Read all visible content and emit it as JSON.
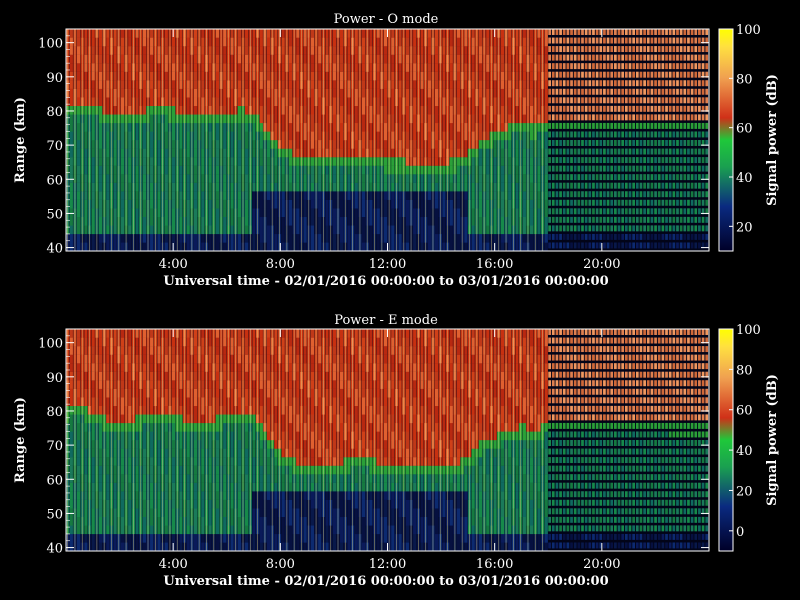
{
  "chart_data": [
    {
      "type": "heatmap",
      "title": "Power - O mode",
      "xlabel": "Universal time - 02/01/2016 00:00:00 to 03/01/2016 00:00:00",
      "ylabel": "Range (km)",
      "xticks": [
        "4:00",
        "8:00",
        "12:00",
        "16:00",
        "20:00"
      ],
      "xtick_hours": [
        4,
        8,
        12,
        16,
        20
      ],
      "xlim_hours": [
        0,
        24
      ],
      "yticks": [
        40,
        50,
        60,
        70,
        80,
        90,
        100
      ],
      "ylim": [
        39,
        104
      ],
      "colorbar": {
        "label": "Signal power (dB)",
        "ticks": [
          20,
          40,
          60,
          80,
          100
        ],
        "range": [
          10,
          100
        ]
      },
      "boundary_profile": {
        "hours": [
          0,
          0.5,
          1,
          1.5,
          2,
          2.5,
          3,
          3.5,
          4,
          4.5,
          5,
          5.5,
          6,
          6.5,
          7,
          7.5,
          8,
          8.5,
          9,
          9.5,
          10,
          10.5,
          11,
          11.5,
          12,
          12.5,
          13,
          13.5,
          14,
          14.5,
          15,
          15.5,
          16,
          16.5,
          17,
          17.5,
          18,
          24
        ],
        "km": [
          80,
          81,
          80,
          78,
          77,
          77,
          79,
          80,
          79,
          78,
          77,
          77,
          78,
          79,
          78,
          73,
          68,
          66,
          65,
          65,
          65,
          66,
          66,
          65,
          64,
          64,
          63,
          63,
          63,
          64,
          66,
          70,
          72,
          74,
          75,
          74,
          75,
          75
        ]
      },
      "dark_floor_km": 57
    },
    {
      "type": "heatmap",
      "title": "Power - E mode",
      "xlabel": "Universal time - 02/01/2016 00:00:00 to 03/01/2016 00:00:00",
      "ylabel": "Range (km)",
      "xticks": [
        "4:00",
        "8:00",
        "12:00",
        "16:00",
        "20:00"
      ],
      "xtick_hours": [
        4,
        8,
        12,
        16,
        20
      ],
      "xlim_hours": [
        0,
        24
      ],
      "yticks": [
        40,
        50,
        60,
        70,
        80,
        90,
        100
      ],
      "ylim": [
        39,
        104
      ],
      "colorbar": {
        "label": "Signal power (dB)",
        "ticks": [
          0,
          20,
          40,
          60,
          80,
          100
        ],
        "range": [
          -10,
          100
        ]
      },
      "boundary_profile": {
        "hours": [
          0,
          0.5,
          1,
          1.5,
          2,
          2.5,
          3,
          3.5,
          4,
          4.5,
          5,
          5.5,
          6,
          6.5,
          7,
          7.5,
          8,
          8.5,
          9,
          9.5,
          10,
          10.5,
          11,
          11.5,
          12,
          12.5,
          13,
          13.5,
          14,
          14.5,
          15,
          15.5,
          16,
          16.5,
          17,
          17.5,
          18,
          24
        ],
        "km": [
          79,
          80,
          78,
          76,
          76,
          76,
          77,
          78,
          77,
          76,
          76,
          76,
          77,
          78,
          77,
          72,
          66,
          64,
          63,
          63,
          63,
          64,
          65,
          64,
          63,
          62,
          62,
          62,
          62,
          63,
          65,
          69,
          71,
          73,
          74,
          73,
          75,
          74
        ]
      },
      "dark_floor_km": 56
    }
  ]
}
